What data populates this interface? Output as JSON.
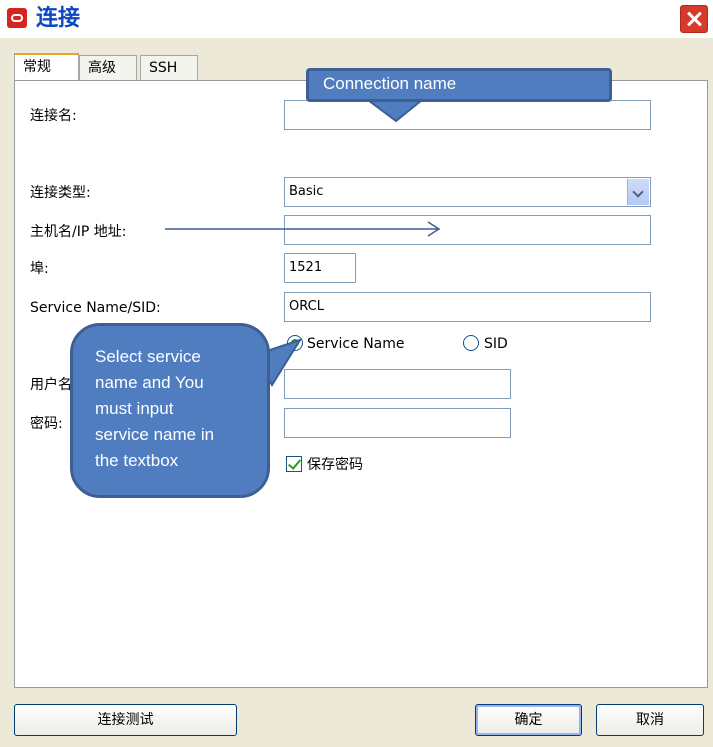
{
  "window": {
    "title": "连接",
    "close_icon": "close-icon",
    "app_icon": "oracle-icon"
  },
  "tabs": [
    {
      "label": "常规",
      "active": true
    },
    {
      "label": "高级",
      "active": false
    },
    {
      "label": "SSH",
      "active": false
    }
  ],
  "form": {
    "connection_name_label": "连接名:",
    "connection_name_value": "",
    "connection_type_label": "连接类型:",
    "connection_type_value": "Basic",
    "hostname_label": "主机名/IP 地址:",
    "hostname_value": "",
    "port_label": "埠:",
    "port_value": "1521",
    "service_label": "Service Name/SID:",
    "service_value": "ORCL",
    "radio_service_name": "Service Name",
    "radio_sid": "SID",
    "selected_radio": "Service Name",
    "username_label": "用户名:",
    "username_value": "",
    "password_label": "密码:",
    "password_value": "",
    "save_password_label": "保存密码",
    "save_password_checked": true
  },
  "buttons": {
    "test": "连接测试",
    "ok": "确定",
    "cancel": "取消"
  },
  "callouts": {
    "top": "Connection name",
    "left_lines": [
      "Select service",
      "name and  You",
      "must input",
      "service name in",
      "the textbox"
    ]
  },
  "colors": {
    "callout_fill": "#4f7dc0",
    "title_text": "#0c47c2",
    "check_green": "#21a121"
  }
}
